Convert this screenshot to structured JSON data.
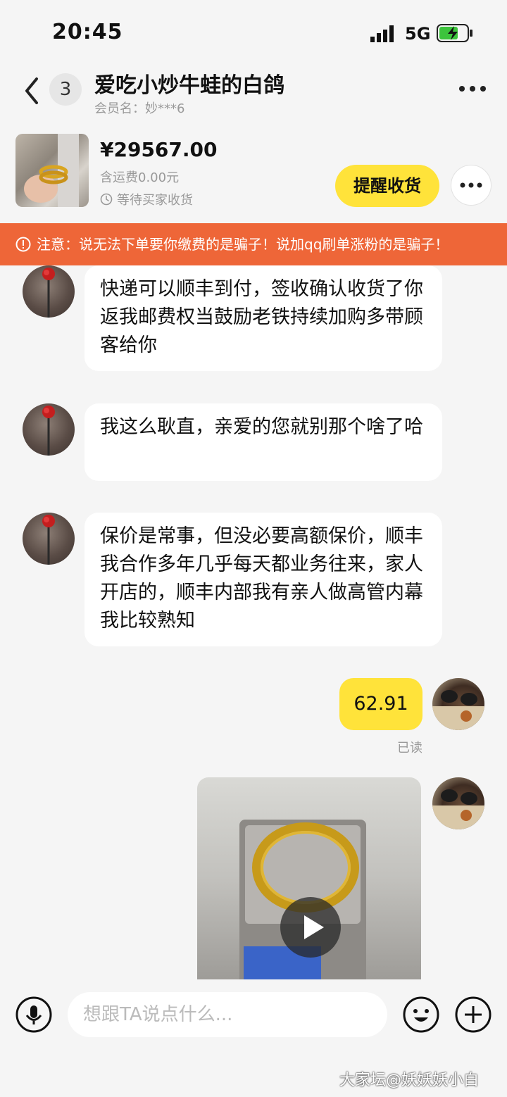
{
  "status_bar": {
    "time": "20:45",
    "network": "5G"
  },
  "header": {
    "unread_count": "3",
    "title": "爱吃小炒牛蛙的白鸽",
    "member": "会员名：妙***6"
  },
  "order": {
    "price": "¥29567.00",
    "shipping": "含运费0.00元",
    "status": "等待买家收货",
    "remind_label": "提醒收货"
  },
  "warning": {
    "text": "注意：说无法下单要你缴费的是骗子！说加qq刷单涨粉的是骗子！"
  },
  "messages": [
    {
      "sender": "other",
      "text": "快递可以顺丰到付，签收确认收货了你返我邮费权当鼓励老铁持续加购多带顾客给你"
    },
    {
      "sender": "other",
      "text": "我这么耿直，亲爱的您就别那个啥了哈"
    },
    {
      "sender": "other",
      "text": "保价是常事，但没必要高额保价，顺丰我合作多年几乎每天都业务往来，家人开店的，顺丰内部我有亲人做高管内幕我比较熟知"
    },
    {
      "sender": "me",
      "text": "62.91",
      "status": "已读"
    }
  ],
  "input": {
    "placeholder": "想跟TA说点什么..."
  },
  "watermark": "大家坛@妖妖妖小白",
  "colors": {
    "accent_yellow": "#ffe33a",
    "warning_orange": "#ee6638",
    "background": "#f5f5f5"
  }
}
